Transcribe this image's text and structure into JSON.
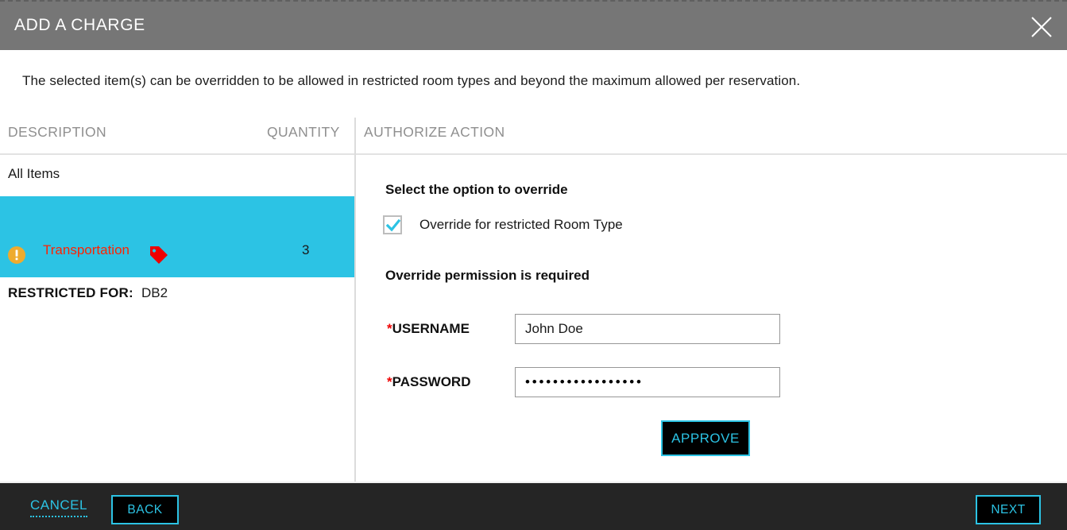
{
  "dialog": {
    "title": "ADD A CHARGE",
    "close_icon": "close-icon",
    "description": "The selected item(s) can be overridden to be allowed in restricted room types and beyond the maximum allowed per reservation."
  },
  "columns": {
    "description": "DESCRIPTION",
    "quantity": "QUANTITY",
    "authorize_action": "AUTHORIZE ACTION"
  },
  "item_list": {
    "all_items_label": "All Items",
    "selected_row": {
      "warning_icon": "warning-exclamation-icon",
      "name": "Transportation",
      "tag_icon": "price-tag-icon",
      "quantity": "3",
      "restricted_label": "RESTRICTED FOR:",
      "restricted_value": "DB2"
    }
  },
  "authorize_panel": {
    "select_heading": "Select the option to override",
    "checkbox": {
      "label": "Override for restricted Room Type",
      "checked": true
    },
    "permission_heading": "Override permission is required",
    "username": {
      "label": "USERNAME",
      "required_marker": "*",
      "value": "John Doe",
      "placeholder": ""
    },
    "password": {
      "label": "PASSWORD",
      "required_marker": "*",
      "masked_value": "•••••••••••••••••",
      "placeholder": ""
    },
    "approve_label": "APPROVE"
  },
  "footer": {
    "cancel_label": "CANCEL",
    "back_label": "BACK",
    "next_label": "NEXT"
  },
  "colors": {
    "titlebar": "#767676",
    "accent_cyan": "#2cc3e4",
    "footer": "#252525",
    "required_red": "#ef0000",
    "item_name_red": "#ff2200",
    "warning_amber": "#eeab2e",
    "tag_red": "#ee0000",
    "header_gray": "#8f8f8f"
  }
}
